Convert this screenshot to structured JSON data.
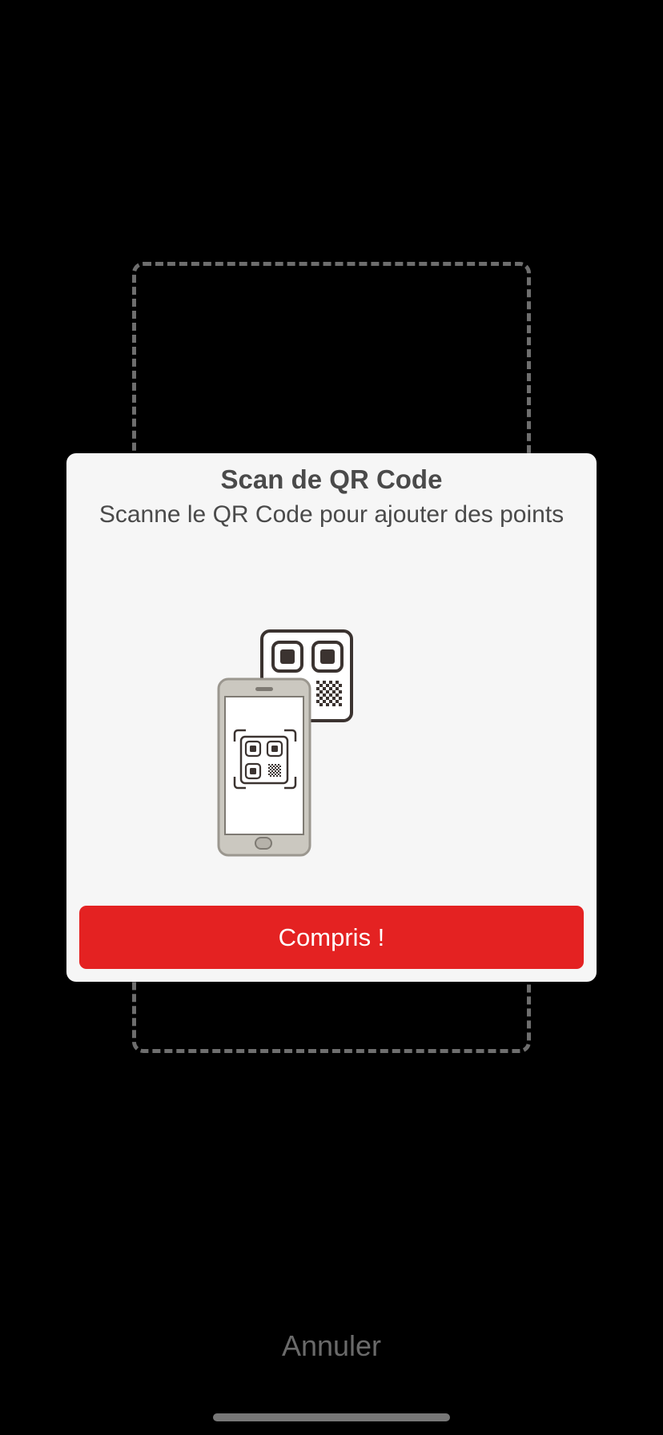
{
  "dialog": {
    "title": "Scan de QR Code",
    "subtitle": "Scanne le QR Code pour ajouter des points",
    "illustration_icon": "phone-scanning-qr-icon",
    "confirm_label": "Compris !"
  },
  "cancel_label": "Annuler",
  "colors": {
    "background": "#000000",
    "dialog_background": "#f6f6f6",
    "accent": "#e42222",
    "text": "#4a4a4a",
    "scan_frame": "#6e6e6e"
  }
}
